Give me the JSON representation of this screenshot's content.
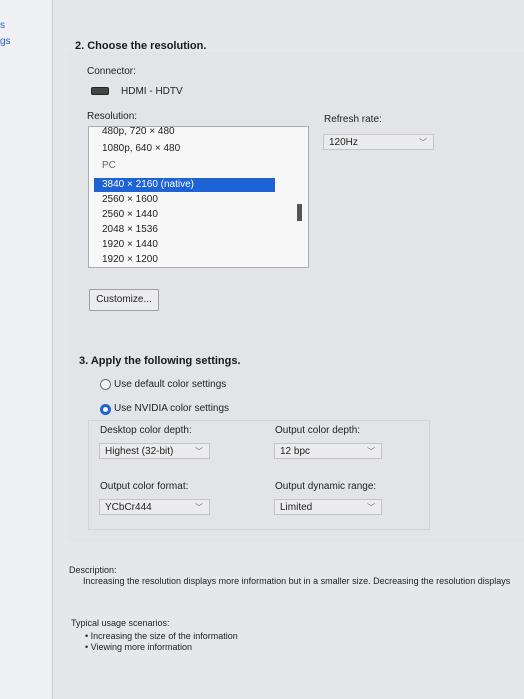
{
  "sidebar": {
    "links": [
      "s",
      "gs"
    ]
  },
  "section2": {
    "heading": "2. Choose the resolution.",
    "connector_label": "Connector:",
    "connector_value": "HDMI - HDTV",
    "resolution_label": "Resolution:",
    "resolutions": [
      {
        "label": "480p, 720 × 480",
        "kind": "item"
      },
      {
        "label": "1080p, 640 × 480",
        "kind": "item"
      },
      {
        "label": "PC",
        "kind": "group"
      },
      {
        "label": "3840 × 2160 (native)",
        "kind": "selected"
      },
      {
        "label": "2560 × 1600",
        "kind": "item"
      },
      {
        "label": "2560 × 1440",
        "kind": "item"
      },
      {
        "label": "2048 × 1536",
        "kind": "item"
      },
      {
        "label": "1920 × 1440",
        "kind": "item"
      },
      {
        "label": "1920 × 1200",
        "kind": "item"
      }
    ],
    "refresh_label": "Refresh rate:",
    "refresh_value": "120Hz",
    "customize_label": "Customize..."
  },
  "section3": {
    "heading": "3. Apply the following settings.",
    "radio_default": "Use default color settings",
    "radio_nvidia": "Use NVIDIA color settings",
    "selected_radio": "nvidia",
    "desktop_depth_label": "Desktop color depth:",
    "desktop_depth_value": "Highest (32-bit)",
    "output_depth_label": "Output color depth:",
    "output_depth_value": "12 bpc",
    "output_format_label": "Output color format:",
    "output_format_value": "YCbCr444",
    "dynamic_range_label": "Output dynamic range:",
    "dynamic_range_value": "Limited"
  },
  "description": {
    "title": "Description:",
    "text": "Increasing the resolution displays more information but in a smaller size. Decreasing the resolution displays"
  },
  "usage": {
    "title": "Typical usage scenarios:",
    "items": [
      "• Increasing the size of the information",
      "• Viewing more information"
    ]
  }
}
